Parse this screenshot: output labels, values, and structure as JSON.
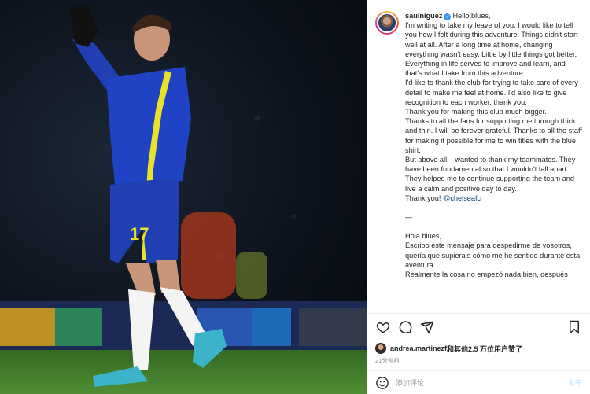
{
  "post": {
    "username": "saulniguez",
    "verified_icon": "verified-badge-icon",
    "player_number": "17",
    "caption_lines": [
      "Hello blues,",
      "I'm writing to take my leave of you. I would like to tell you how I felt during this adventure. Things didn't start well at all. After a long time at home, changing everything wasn't easy. Little by little things got better.",
      "Everything in life serves to improve and learn, and that's what I take from this adventure.",
      "I'd like to thank the club for trying to take care of every detail to make me feel at home. I'd also like to give recognition to each worker, thank you.",
      "Thank you for making this club much bigger.",
      "Thanks to all the fans for supporting me through thick and thin. I will be forever grateful. Thanks to all the staff for making it possible for me to win titles with the blue shirt.",
      "But above all, I wanted to thank my teammates. They have been fundamental so that I wouldn't fall apart. They helped me to continue supporting the team and live a calm and positive day to day.",
      "Thank you!",
      "@chelseafc",
      "—",
      "Hola blues,",
      "Escribo este mensaje para despedirme de vosotros, quería que supierais cómo me he sentido durante esta aventura.",
      "Realmente la cosa no empezó nada bien, después"
    ],
    "likes_text_user": "andrea.martinezf",
    "likes_text_rest": "和其他2.5 万位用户赞了",
    "timestamp": "21分钟前",
    "comment_placeholder": "添加评论...",
    "post_button": "发布",
    "colors": {
      "link": "#00376b",
      "verified": "#3897f0",
      "muted": "#8e8e8e",
      "post_button": "#b2dffc"
    },
    "icons": [
      "heart-icon",
      "comment-icon",
      "share-icon",
      "bookmark-icon",
      "emoji-icon"
    ]
  }
}
